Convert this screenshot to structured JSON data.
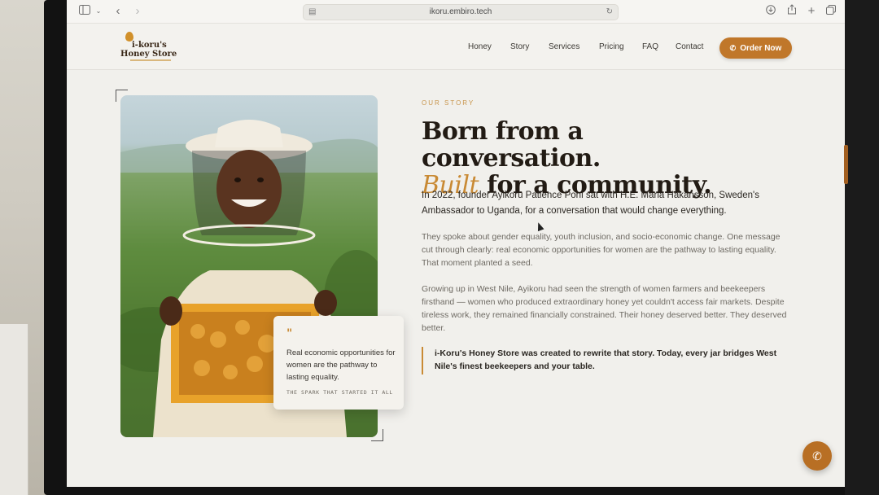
{
  "browser": {
    "url": "ikoru.embiro.tech",
    "icons": [
      "sidebar-icon",
      "chevron-down-icon",
      "back-icon",
      "forward-icon",
      "download-icon",
      "share-icon",
      "new-tab-icon",
      "tabs-icon",
      "reload-icon"
    ]
  },
  "site": {
    "logo": {
      "line1": "i-koru's",
      "line2": "Honey Store"
    },
    "nav": [
      "Honey",
      "Story",
      "Services",
      "Pricing",
      "FAQ",
      "Contact"
    ],
    "order_button": "Order Now",
    "accent_color": "#c0772a"
  },
  "story": {
    "eyebrow": "OUR STORY",
    "headline_line1": "Born from a conversation.",
    "headline_accent": "Built",
    "headline_line2_rest": " for a community.",
    "lead": "In 2022, founder Ayikoru Patience Poni sat with H.E. Maria Hakansson, Sweden's Ambassador to Uganda, for a conversation that would change everything.",
    "para1": "They spoke about gender equality, youth inclusion, and socio-economic change. One message cut through clearly: real economic opportunities for women are the pathway to lasting equality. That moment planted a seed.",
    "para2": "Growing up in West Nile, Ayikoru had seen the strength of women farmers and beekeepers firsthand — women who produced extraordinary honey yet couldn't access fair markets. Despite tireless work, they remained financially constrained. Their honey deserved better. They deserved better.",
    "callout": "i-Koru's Honey Store was created to rewrite that story. Today, every jar bridges West Nile's finest beekeepers and your table."
  },
  "quote_card": {
    "mark": "\"",
    "text": "Real economic opportunities for women are the pathway to lasting equality.",
    "source": "THE SPARK THAT STARTED IT ALL"
  }
}
